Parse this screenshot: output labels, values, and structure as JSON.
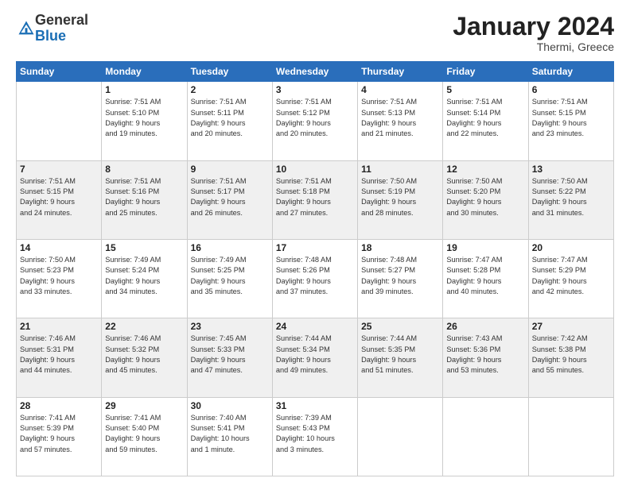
{
  "logo": {
    "general": "General",
    "blue": "Blue"
  },
  "header": {
    "month": "January 2024",
    "location": "Thermi, Greece"
  },
  "weekdays": [
    "Sunday",
    "Monday",
    "Tuesday",
    "Wednesday",
    "Thursday",
    "Friday",
    "Saturday"
  ],
  "weeks": [
    [
      {
        "day": "",
        "info": ""
      },
      {
        "day": "1",
        "info": "Sunrise: 7:51 AM\nSunset: 5:10 PM\nDaylight: 9 hours\nand 19 minutes."
      },
      {
        "day": "2",
        "info": "Sunrise: 7:51 AM\nSunset: 5:11 PM\nDaylight: 9 hours\nand 20 minutes."
      },
      {
        "day": "3",
        "info": "Sunrise: 7:51 AM\nSunset: 5:12 PM\nDaylight: 9 hours\nand 20 minutes."
      },
      {
        "day": "4",
        "info": "Sunrise: 7:51 AM\nSunset: 5:13 PM\nDaylight: 9 hours\nand 21 minutes."
      },
      {
        "day": "5",
        "info": "Sunrise: 7:51 AM\nSunset: 5:14 PM\nDaylight: 9 hours\nand 22 minutes."
      },
      {
        "day": "6",
        "info": "Sunrise: 7:51 AM\nSunset: 5:15 PM\nDaylight: 9 hours\nand 23 minutes."
      }
    ],
    [
      {
        "day": "7",
        "info": "Sunrise: 7:51 AM\nSunset: 5:15 PM\nDaylight: 9 hours\nand 24 minutes."
      },
      {
        "day": "8",
        "info": "Sunrise: 7:51 AM\nSunset: 5:16 PM\nDaylight: 9 hours\nand 25 minutes."
      },
      {
        "day": "9",
        "info": "Sunrise: 7:51 AM\nSunset: 5:17 PM\nDaylight: 9 hours\nand 26 minutes."
      },
      {
        "day": "10",
        "info": "Sunrise: 7:51 AM\nSunset: 5:18 PM\nDaylight: 9 hours\nand 27 minutes."
      },
      {
        "day": "11",
        "info": "Sunrise: 7:50 AM\nSunset: 5:19 PM\nDaylight: 9 hours\nand 28 minutes."
      },
      {
        "day": "12",
        "info": "Sunrise: 7:50 AM\nSunset: 5:20 PM\nDaylight: 9 hours\nand 30 minutes."
      },
      {
        "day": "13",
        "info": "Sunrise: 7:50 AM\nSunset: 5:22 PM\nDaylight: 9 hours\nand 31 minutes."
      }
    ],
    [
      {
        "day": "14",
        "info": "Sunrise: 7:50 AM\nSunset: 5:23 PM\nDaylight: 9 hours\nand 33 minutes."
      },
      {
        "day": "15",
        "info": "Sunrise: 7:49 AM\nSunset: 5:24 PM\nDaylight: 9 hours\nand 34 minutes."
      },
      {
        "day": "16",
        "info": "Sunrise: 7:49 AM\nSunset: 5:25 PM\nDaylight: 9 hours\nand 35 minutes."
      },
      {
        "day": "17",
        "info": "Sunrise: 7:48 AM\nSunset: 5:26 PM\nDaylight: 9 hours\nand 37 minutes."
      },
      {
        "day": "18",
        "info": "Sunrise: 7:48 AM\nSunset: 5:27 PM\nDaylight: 9 hours\nand 39 minutes."
      },
      {
        "day": "19",
        "info": "Sunrise: 7:47 AM\nSunset: 5:28 PM\nDaylight: 9 hours\nand 40 minutes."
      },
      {
        "day": "20",
        "info": "Sunrise: 7:47 AM\nSunset: 5:29 PM\nDaylight: 9 hours\nand 42 minutes."
      }
    ],
    [
      {
        "day": "21",
        "info": "Sunrise: 7:46 AM\nSunset: 5:31 PM\nDaylight: 9 hours\nand 44 minutes."
      },
      {
        "day": "22",
        "info": "Sunrise: 7:46 AM\nSunset: 5:32 PM\nDaylight: 9 hours\nand 45 minutes."
      },
      {
        "day": "23",
        "info": "Sunrise: 7:45 AM\nSunset: 5:33 PM\nDaylight: 9 hours\nand 47 minutes."
      },
      {
        "day": "24",
        "info": "Sunrise: 7:44 AM\nSunset: 5:34 PM\nDaylight: 9 hours\nand 49 minutes."
      },
      {
        "day": "25",
        "info": "Sunrise: 7:44 AM\nSunset: 5:35 PM\nDaylight: 9 hours\nand 51 minutes."
      },
      {
        "day": "26",
        "info": "Sunrise: 7:43 AM\nSunset: 5:36 PM\nDaylight: 9 hours\nand 53 minutes."
      },
      {
        "day": "27",
        "info": "Sunrise: 7:42 AM\nSunset: 5:38 PM\nDaylight: 9 hours\nand 55 minutes."
      }
    ],
    [
      {
        "day": "28",
        "info": "Sunrise: 7:41 AM\nSunset: 5:39 PM\nDaylight: 9 hours\nand 57 minutes."
      },
      {
        "day": "29",
        "info": "Sunrise: 7:41 AM\nSunset: 5:40 PM\nDaylight: 9 hours\nand 59 minutes."
      },
      {
        "day": "30",
        "info": "Sunrise: 7:40 AM\nSunset: 5:41 PM\nDaylight: 10 hours\nand 1 minute."
      },
      {
        "day": "31",
        "info": "Sunrise: 7:39 AM\nSunset: 5:43 PM\nDaylight: 10 hours\nand 3 minutes."
      },
      {
        "day": "",
        "info": ""
      },
      {
        "day": "",
        "info": ""
      },
      {
        "day": "",
        "info": ""
      }
    ]
  ]
}
